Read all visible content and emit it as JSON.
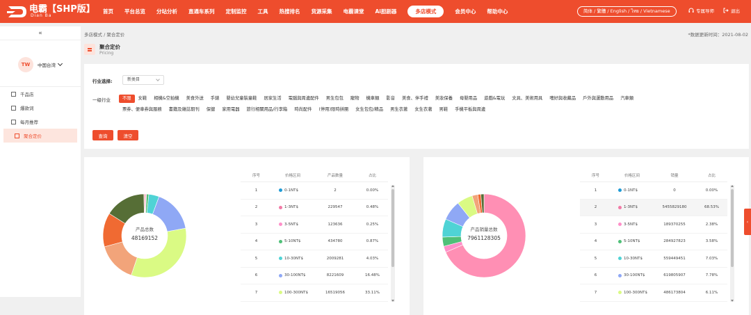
{
  "header": {
    "logo_title": "电霸【SHP版】",
    "logo_sub": "Dian Ba",
    "nav": [
      "首页",
      "平台总览",
      "分站分析",
      "直通车系列",
      "定制监控",
      "工具",
      "热搜排名",
      "货源采集",
      "电霸课堂",
      "Ai胆剧器"
    ],
    "nav_active": "多店模式",
    "nav_after": [
      "会员中心",
      "帮助中心"
    ],
    "lang": "简体 / 繁體 / English / ไทย / Vietnamese",
    "service": "专属导师",
    "logout": "退出",
    "brand_color": "#ee4d2d"
  },
  "sidebar": {
    "collapse": "«",
    "avatar": "TW",
    "region": "中国台湾",
    "items": [
      {
        "label": "千品店",
        "icon": "shop-icon"
      },
      {
        "label": "爆款词",
        "icon": "grid-icon"
      },
      {
        "label": "每月推荐",
        "icon": "trend-icon"
      },
      {
        "label": "聚合定价",
        "icon": "wallet-icon",
        "active": true
      }
    ]
  },
  "main": {
    "breadcrumb": "多店模式 / 聚合定价",
    "update_time": "*数据更新时间：2021-08-02",
    "title": "聚合定价",
    "subtitle": "Pricing"
  },
  "filter": {
    "industry_label": "行业选择:",
    "industry_value": "新类目",
    "level_label": "一级行业",
    "categories": [
      "不限",
      "女鞋",
      "相機&空拍機",
      "美食外送",
      "手錶",
      "嬰幼兒童裝童鞋",
      "居家生活",
      "電腦與周邊配件",
      "男生包包",
      "寵物",
      "機車類",
      "影音",
      "美食、伴手禮",
      "美妝保養",
      "母嬰用品",
      "遊戲&電玩",
      "文具、美術用具",
      "嗜好與收藏品",
      "戶外與運動用品",
      "汽車類",
      "票券、便車券與服務",
      "書籍及雜誌期刊",
      "保健",
      "家用電器",
      "旅行相關用品/行李箱",
      "時尚配件",
      "(停用)限時拼團",
      "女生包包/精品",
      "男生衣著",
      "女生衣著",
      "男鞋",
      "手機平板與周邊"
    ],
    "active_category": "不限",
    "query_btn": "查询",
    "clear_btn": "清空"
  },
  "left_panel": {
    "center_label": "产品总数",
    "center_value": "48169152",
    "headers": [
      "序号",
      "价格区间",
      "产品数量",
      "占比"
    ],
    "rows": [
      {
        "no": "1",
        "range": "0-1NT$",
        "value": "2",
        "pct": "0.00%",
        "color": "#1f9bd6"
      },
      {
        "no": "2",
        "range": "1-3NT$",
        "value": "229547",
        "pct": "0.48%",
        "color": "#f27aa6"
      },
      {
        "no": "3",
        "range": "3-5NT$",
        "value": "123636",
        "pct": "0.25%",
        "color": "#ff8fc9"
      },
      {
        "no": "4",
        "range": "5-10NT$",
        "value": "434780",
        "pct": "0.87%",
        "color": "#4fc078"
      },
      {
        "no": "5",
        "range": "10-30NT$",
        "value": "2009281",
        "pct": "4.03%",
        "color": "#4fd3d5"
      },
      {
        "no": "6",
        "range": "30-100NT$",
        "value": "8221609",
        "pct": "16.48%",
        "color": "#8fa8f5"
      },
      {
        "no": "7",
        "range": "100-300NT$",
        "value": "16519056",
        "pct": "33.11%",
        "color": "#dafa84"
      }
    ],
    "slices": [
      {
        "pct": 0.48,
        "color": "#f27aa6"
      },
      {
        "pct": 0.25,
        "color": "#ff8fc9"
      },
      {
        "pct": 0.87,
        "color": "#4fc078"
      },
      {
        "pct": 4.03,
        "color": "#4fd3d5"
      },
      {
        "pct": 16.48,
        "color": "#8fa8f5"
      },
      {
        "pct": 33.11,
        "color": "#dafa84"
      },
      {
        "pct": 15.5,
        "color": "#f2a47a"
      },
      {
        "pct": 13.2,
        "color": "#f06a32"
      },
      {
        "pct": 15.8,
        "color": "#566e36"
      },
      {
        "pct": 0.28,
        "color": "#e8a080"
      }
    ]
  },
  "right_panel": {
    "center_label": "产品销量总数",
    "center_value": "7961128305",
    "headers": [
      "序号",
      "价格区间",
      "销量",
      "占比"
    ],
    "rows": [
      {
        "no": "1",
        "range": "0-1NT$",
        "value": "0",
        "pct": "0.00%",
        "color": "#1f9bd6"
      },
      {
        "no": "2",
        "range": "1-3NT$",
        "value": "5455829180",
        "pct": "68.53%",
        "color": "#f27aa6"
      },
      {
        "no": "3",
        "range": "3-5NT$",
        "value": "189370255",
        "pct": "2.38%",
        "color": "#ff8fc9"
      },
      {
        "no": "4",
        "range": "5-10NT$",
        "value": "284927823",
        "pct": "3.58%",
        "color": "#4fc078"
      },
      {
        "no": "5",
        "range": "10-30NT$",
        "value": "559449451",
        "pct": "7.03%",
        "color": "#4fd3d5"
      },
      {
        "no": "6",
        "range": "30-100NT$",
        "value": "619805907",
        "pct": "7.78%",
        "color": "#8fa8f5"
      },
      {
        "no": "7",
        "range": "100-300NT$",
        "value": "486173804",
        "pct": "6.11%",
        "color": "#dafa84"
      }
    ],
    "slices": [
      {
        "pct": 68.53,
        "color": "#ff8fb4"
      },
      {
        "pct": 2.38,
        "color": "#ff8fc9"
      },
      {
        "pct": 3.58,
        "color": "#4fc078"
      },
      {
        "pct": 7.03,
        "color": "#4fd3d5"
      },
      {
        "pct": 7.78,
        "color": "#8fa8f5"
      },
      {
        "pct": 6.11,
        "color": "#dafa84"
      },
      {
        "pct": 2.2,
        "color": "#f2a47a"
      },
      {
        "pct": 1.2,
        "color": "#f06a32"
      },
      {
        "pct": 1.19,
        "color": "#566e36"
      }
    ]
  }
}
